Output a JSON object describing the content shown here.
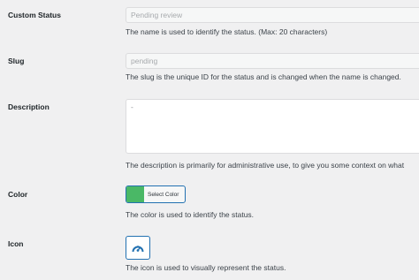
{
  "fields": {
    "custom_status": {
      "label": "Custom Status",
      "value": "Pending review",
      "description": "The name is used to identify the status. (Max: 20 characters)"
    },
    "slug": {
      "label": "Slug",
      "value": "pending",
      "description": "The slug is the unique ID for the status and is changed when the name is changed."
    },
    "description": {
      "label": "Description",
      "value": "-",
      "description": "The description is primarily for administrative use, to give you some context on what"
    },
    "color": {
      "label": "Color",
      "swatch_color": "#4ab866",
      "button_label": "Select Color",
      "description": "The color is used to identify the status."
    },
    "icon": {
      "label": "Icon",
      "icon_name": "dashboard-gauge-icon",
      "description": "The icon is used to visually represent the status."
    }
  },
  "colors": {
    "accent": "#2271b1",
    "background": "#f0f0f1"
  }
}
